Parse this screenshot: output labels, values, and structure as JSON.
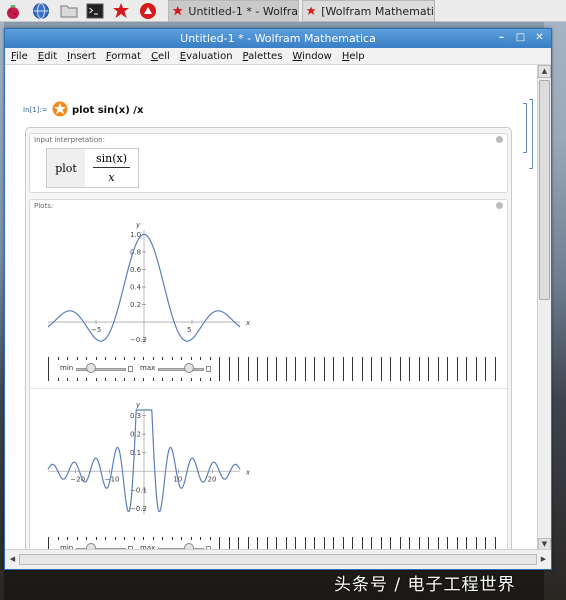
{
  "taskbar": {
    "launchers": [
      {
        "icon": "raspberry-icon",
        "color": "#c51a4a"
      },
      {
        "icon": "globe-icon",
        "color": "#3a6fc4"
      },
      {
        "icon": "folder-icon",
        "color": "#8a8a8a"
      },
      {
        "icon": "terminal-icon",
        "color": "#222222"
      },
      {
        "icon": "mathematica-icon",
        "color": "#d51b1b"
      },
      {
        "icon": "wolfram-icon",
        "color": "#d51b1b"
      }
    ],
    "tasks": [
      {
        "label": "Untitled-1 * - Wolfra",
        "icon": "mathematica-icon",
        "active": true
      },
      {
        "label": "[Wolfram Mathemati",
        "icon": "mathematica-icon",
        "active": false
      }
    ]
  },
  "window": {
    "title": "Untitled-1 * - Wolfram Mathematica",
    "controls": [
      "–",
      "□",
      "✕"
    ]
  },
  "menu": [
    {
      "label": "File",
      "ul": "F",
      "rest": "ile"
    },
    {
      "label": "Edit",
      "ul": "E",
      "rest": "dit"
    },
    {
      "label": "Insert",
      "ul": "I",
      "rest": "nsert"
    },
    {
      "label": "Format",
      "ul": "F",
      "rest": "ormat"
    },
    {
      "label": "Cell",
      "ul": "C",
      "rest": "ell"
    },
    {
      "label": "Evaluation",
      "ul": "E",
      "rest": "valuation"
    },
    {
      "label": "Palettes",
      "ul": "P",
      "rest": "alettes"
    },
    {
      "label": "Window",
      "ul": "W",
      "rest": "indow"
    },
    {
      "label": "Help",
      "ul": "H",
      "rest": "elp"
    }
  ],
  "notebook": {
    "input_label": "In[1]:=",
    "input_text": "plot sin(x) /x",
    "interp_pod": {
      "title": "Input interpretation:",
      "left": "plot",
      "numerator": "sin(x)",
      "denominator": "x"
    },
    "plots_pod": {
      "title": "Plots:"
    },
    "slider_labels": {
      "min": "min",
      "max": "max"
    }
  },
  "chart_data": [
    {
      "type": "line",
      "title": "",
      "xlabel": "x",
      "ylabel": "y",
      "xlim": [
        -10,
        10
      ],
      "ylim": [
        -0.25,
        1.05
      ],
      "x_ticks": [
        -5,
        5
      ],
      "y_ticks": [
        -0.2,
        0.2,
        0.4,
        0.6,
        0.8,
        1.0
      ],
      "y_tick_labels": [
        "−0.2",
        "0.2",
        "0.4",
        "0.6",
        "0.8",
        "1.0"
      ],
      "x_tick_labels": [
        "−5",
        "5"
      ],
      "series": [
        {
          "function": "sin(x)/x",
          "color": "#5b7fb8"
        }
      ],
      "x": [
        -10,
        -9,
        -8,
        -7,
        -6,
        -5,
        -4,
        -3,
        -2,
        -1,
        0,
        1,
        2,
        3,
        4,
        5,
        6,
        7,
        8,
        9,
        10
      ],
      "y": [
        -0.054,
        0.046,
        0.124,
        0.094,
        -0.047,
        -0.192,
        -0.189,
        0.047,
        0.455,
        0.841,
        1.0,
        0.841,
        0.455,
        0.047,
        -0.189,
        -0.192,
        -0.047,
        0.094,
        0.124,
        0.046,
        -0.054
      ]
    },
    {
      "type": "line",
      "title": "",
      "xlabel": "x",
      "ylabel": "y",
      "xlim": [
        -28,
        28
      ],
      "ylim": [
        -0.23,
        0.33
      ],
      "x_ticks": [
        -20,
        -10,
        10,
        20
      ],
      "x_tick_labels": [
        "−20",
        "−10",
        "10",
        "20"
      ],
      "y_ticks": [
        -0.2,
        -0.1,
        0.1,
        0.2,
        0.3
      ],
      "y_tick_labels": [
        "−0.2",
        "−0.1",
        "0.1",
        "0.2",
        "0.3"
      ],
      "series": [
        {
          "function": "sin(x)/x (zoomed)",
          "color": "#5b7fb8"
        }
      ]
    }
  ],
  "watermark": {
    "text": "头条号 / 电子工程世界"
  }
}
